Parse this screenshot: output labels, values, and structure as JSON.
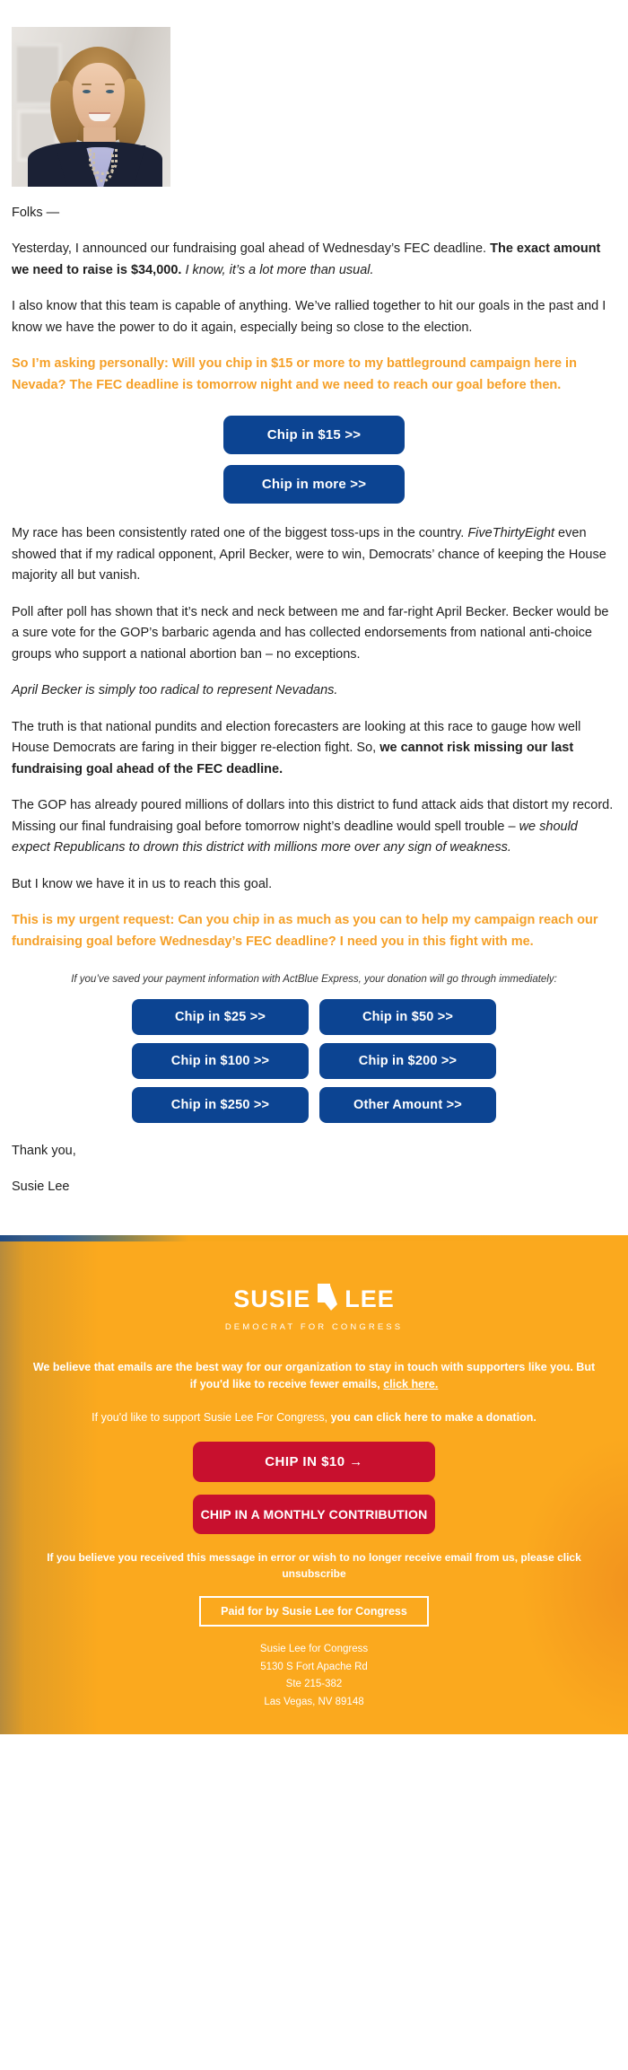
{
  "letter": {
    "greeting": "Folks —",
    "p1_part1": "Yesterday, I announced our fundraising goal ahead of Wednesday’s FEC deadline. ",
    "p1_bold": "The exact amount we need to raise is $34,000.",
    "p1_italic": " I know, it’s a lot more than usual.",
    "p2": "I also know that this team is capable of anything. We’ve rallied together to hit our goals in the past and I know we have the power to do it again, especially being so close to the election.",
    "ask1": "So I’m asking personally: Will you chip in $15 or more to my battleground campaign here in Nevada? The FEC deadline is tomorrow night and we need to reach our goal before then.",
    "p3_part1": "My race has been consistently rated one of the biggest toss-ups in the country. ",
    "p3_italic": "FiveThirtyEight",
    "p3_part2": " even showed that if my radical opponent, April Becker, were to win, Democrats’ chance of keeping the House majority all but vanish.",
    "p4": "Poll after poll has shown that it’s neck and neck between me and far-right April Becker. Becker would be a sure vote for the GOP’s barbaric agenda and has collected endorsements from national anti-choice groups who support a national abortion ban – no exceptions.",
    "p5_italic": "April Becker is simply too radical to represent Nevadans.",
    "p6_part1": "The truth is that national pundits and election forecasters are looking at this race to gauge how well House Democrats are faring in their bigger re-election fight. So, ",
    "p6_bold": "we cannot risk missing our last fundraising goal ahead of the FEC deadline.",
    "p7_part1": "The GOP has already poured millions of dollars into this district to fund attack aids that distort my record. Missing our final fundraising goal before tomorrow night’s deadline would spell trouble – ",
    "p7_italic": "we should expect Republicans to drown this district with millions more over any sign of weakness.",
    "p8": "But I know we have it in us to reach this goal.",
    "ask2": "This is my urgent request: Can you chip in as much as you can to help my campaign reach our fundraising goal before Wednesday’s FEC deadline? I need you in this fight with me.",
    "express_note": "If you’ve saved your payment information with ActBlue Express, your donation will go through immediately:",
    "thanks": "Thank you,",
    "signature": "Susie Lee"
  },
  "cta_primary": {
    "buttons": [
      {
        "label": "Chip in $15 >>"
      },
      {
        "label": "Chip in more >>"
      }
    ]
  },
  "cta_grid": {
    "buttons": [
      {
        "label": "Chip in $25 >>"
      },
      {
        "label": "Chip in $50 >>"
      },
      {
        "label": "Chip in $100 >>"
      },
      {
        "label": "Chip in $200 >>"
      },
      {
        "label": "Chip in $250 >>"
      },
      {
        "label": "Other Amount >>"
      }
    ]
  },
  "footer": {
    "logo": {
      "word1": "SUSIE",
      "word2": "LEE",
      "tagline": "DEMOCRAT FOR CONGRESS"
    },
    "emails_note_part1": "We believe that emails are the best way for our organization to stay in touch with supporters like you. But if you'd like to receive fewer emails, ",
    "emails_note_link": "click here.",
    "support_note_part1": "If you'd like to support Susie Lee For Congress, ",
    "support_note_bold": "you can click here to make a donation.",
    "red_buttons": [
      {
        "label": "CHIP IN $10 →"
      },
      {
        "label": "CHIP IN A MONTHLY CONTRIBUTION"
      }
    ],
    "unsubscribe_note": "If you believe you received this message in error or wish to no longer receive email from us, please click unsubscribe",
    "paid_for": "Paid for by Susie Lee for Congress",
    "address": [
      "Susie Lee for Congress",
      "5130 S Fort Apache Rd",
      "Ste 215-382",
      "Las Vegas, NV 89148"
    ]
  },
  "colors": {
    "accent_orange": "#f5a028",
    "footer_bg": "#fba91e",
    "button_blue": "#0c4492",
    "button_red": "#c8102e"
  }
}
